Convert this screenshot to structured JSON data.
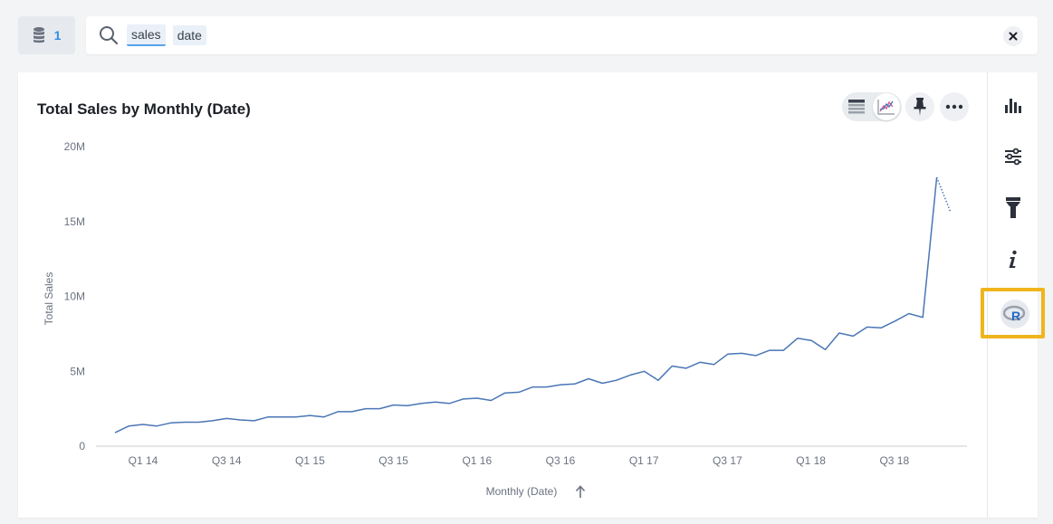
{
  "source": {
    "count": "1",
    "icon": "database-icon"
  },
  "search": {
    "tokens": [
      "sales",
      "date"
    ],
    "clear_icon": "close-icon"
  },
  "chart_header": {
    "title": "Total Sales by Monthly (Date)"
  },
  "toolbar": {
    "table_icon": "table-icon",
    "chart_icon": "line-chart-icon",
    "pin_icon": "pin-icon",
    "more_icon": "more-icon"
  },
  "side_rail": {
    "items": [
      "bar-chart-icon",
      "sliders-icon",
      "filter-icon",
      "info-icon",
      "r-analysis-icon"
    ]
  },
  "colors": {
    "line": "#4a76b5",
    "highlight": "#f0b51d",
    "accent": "#2f8fe4"
  },
  "chart_data": {
    "type": "line",
    "title": "Total Sales by Monthly (Date)",
    "xlabel": "Monthly (Date)",
    "ylabel": "Total Sales",
    "sort_indicator": "ascending",
    "yticks": [
      {
        "value": 0,
        "label": "0"
      },
      {
        "value": 5000000,
        "label": "5M"
      },
      {
        "value": 10000000,
        "label": "10M"
      },
      {
        "value": 15000000,
        "label": "15M"
      },
      {
        "value": 20000000,
        "label": "20M"
      }
    ],
    "ylim": [
      0,
      20000000
    ],
    "xtick_labels": [
      "Q1 14",
      "Q3 14",
      "Q1 15",
      "Q3 15",
      "Q1 16",
      "Q3 16",
      "Q1 17",
      "Q3 17",
      "Q1 18",
      "Q3 18"
    ],
    "series": [
      {
        "values": [
          0.9,
          1.35,
          1.45,
          1.35,
          1.55,
          1.6,
          1.6,
          1.7,
          1.85,
          1.75,
          1.7,
          1.95,
          1.95,
          1.95,
          2.05,
          1.95,
          2.3,
          2.3,
          2.5,
          2.5,
          2.75,
          2.7,
          2.85,
          2.95,
          2.85,
          3.15,
          3.2,
          3.05,
          3.55,
          3.6,
          3.95,
          3.95,
          4.1,
          4.15,
          4.5,
          4.2,
          4.4,
          4.75,
          5.0,
          4.4,
          5.35,
          5.2,
          5.6,
          5.45,
          6.15,
          6.2,
          6.05,
          6.4,
          6.4,
          7.2,
          7.05,
          6.45,
          7.55,
          7.35,
          7.95,
          7.9,
          8.35,
          8.85,
          8.6,
          17.95,
          15.6
        ],
        "projected_from_index": 59
      }
    ]
  }
}
